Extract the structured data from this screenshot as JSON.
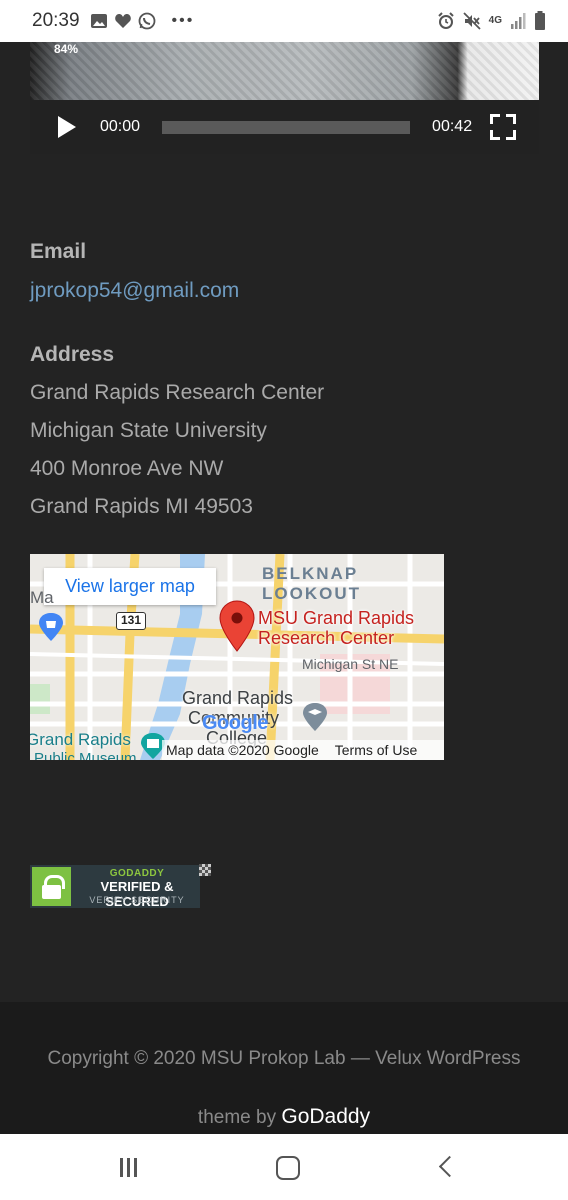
{
  "status_bar": {
    "time": "20:39",
    "left_icons": [
      "image-icon",
      "heart-icon",
      "whatsapp-icon",
      "more-dots-icon"
    ],
    "network_label": "4G",
    "right_icons": [
      "alarm-icon",
      "mute-icon",
      "signal-icon",
      "battery-icon"
    ]
  },
  "video": {
    "overlay_text": "84%",
    "current_time": "00:00",
    "duration": "00:42",
    "progress": 0
  },
  "contact": {
    "email_label": "Email",
    "email_value": "jprokop54@gmail.com",
    "address_label": "Address",
    "address_lines": [
      "Grand Rapids Research Center",
      "Michigan State University",
      "400 Monroe Ave NW",
      "Grand Rapids MI 49503"
    ]
  },
  "map": {
    "view_larger": "View larger map",
    "marker_label_1": "MSU Grand Rapids",
    "marker_label_2": "Research Center",
    "area_label_1": "BELKNAP",
    "area_label_2": "LOOKOUT",
    "street": "Michigan St NE",
    "highway": "131",
    "place_1": "Grand Rapids",
    "place_2": "Community",
    "place_3": "College",
    "place_4": "Grand Rapids",
    "place_5": "Public Museum",
    "edge_label": "Ma",
    "attribution": "Map data ©2020 Google",
    "terms": "Terms of Use",
    "logo": "Google"
  },
  "badge": {
    "brand": "GODADDY",
    "title": "VERIFIED & SECURED",
    "subtitle": "VERIFY SECURITY"
  },
  "footer": {
    "copyright": "Copyright © 2020 MSU Prokop Lab — Velux WordPress",
    "theme_prefix": "theme by ",
    "theme_link": "GoDaddy"
  },
  "colors": {
    "background": "#232323",
    "footer_bg": "#1b1b1b",
    "link": "#6f9bc0",
    "map_marker": "#ea4335",
    "badge_green": "#7dc142"
  }
}
